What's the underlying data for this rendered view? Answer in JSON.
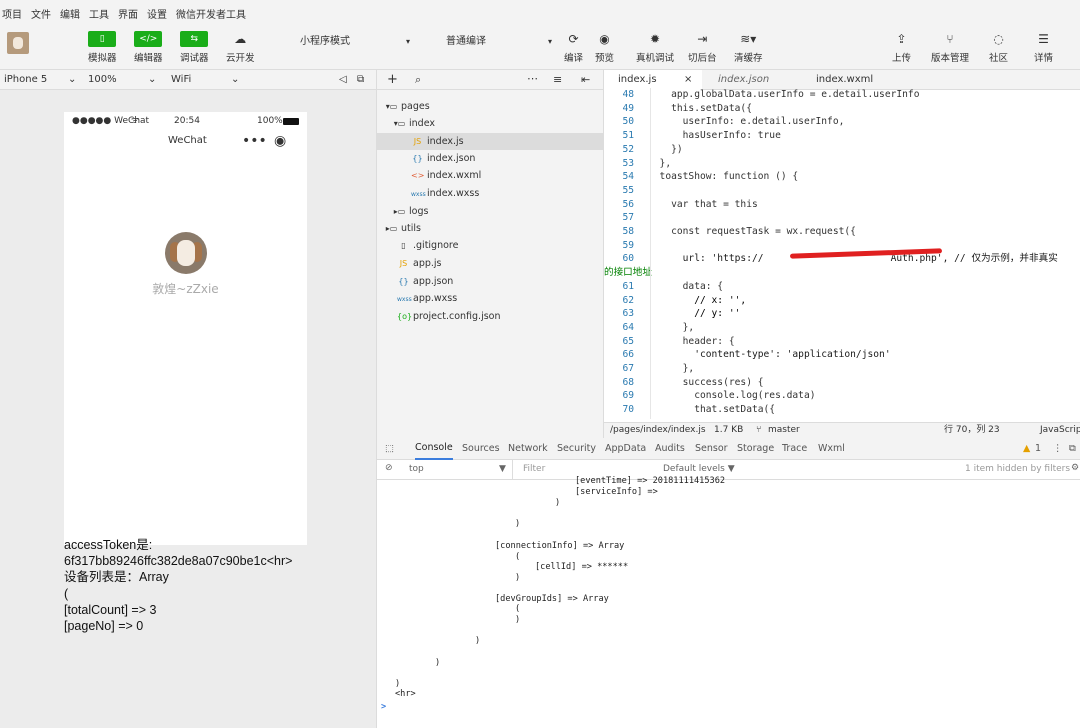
{
  "menu": [
    "项目",
    "文件",
    "编辑",
    "工具",
    "界面",
    "设置",
    "微信开发者工具"
  ],
  "toolbar": {
    "simulator": "模拟器",
    "editor": "编辑器",
    "debugger": "调试器",
    "cloud": "云开发",
    "mode": "小程序模式",
    "compile_mode": "普通编译",
    "compile": "编译",
    "preview": "预览",
    "remote_debug": "真机调试",
    "background": "切后台",
    "clear_cache": "清缓存",
    "upload": "上传",
    "version": "版本管理",
    "community": "社区",
    "details": "详情"
  },
  "device": {
    "model": "iPhone 5",
    "zoom": "100%",
    "network": "WiFi"
  },
  "phone": {
    "carrier": "●●●●● WeChat",
    "time": "20:54",
    "battery": "100%",
    "title": "WeChat",
    "nickname": "敦煌~zZxie"
  },
  "output": [
    "accessToken是:",
    "6f317bb89246ffc382de8a07c90be1c<hr>",
    "设备列表是：Array",
    "(",
    "[totalCount] => 3",
    "[pageNo] => 0"
  ],
  "files": {
    "pages": "pages",
    "index": "index",
    "index_js": "index.js",
    "index_json": "index.json",
    "index_wxml": "index.wxml",
    "index_wxss": "index.wxss",
    "logs": "logs",
    "utils": "utils",
    "gitignore": ".gitignore",
    "app_js": "app.js",
    "app_json": "app.json",
    "app_wxss": "app.wxss",
    "project_config": "project.config.json"
  },
  "editor_tabs": [
    "index.js",
    "index.json",
    "index.wxml"
  ],
  "code_lines": [
    {
      "n": "48",
      "t": "    app.globalData.userInfo = e.detail.userInfo"
    },
    {
      "n": "49",
      "t": "    this.setData({"
    },
    {
      "n": "50",
      "t": "      userInfo: e.detail.userInfo,"
    },
    {
      "n": "51",
      "t": "      hasUserInfo: true"
    },
    {
      "n": "52",
      "t": "    })"
    },
    {
      "n": "53",
      "t": "  },"
    },
    {
      "n": "54",
      "t": "  toastShow: function () {"
    },
    {
      "n": "55",
      "t": ""
    },
    {
      "n": "56",
      "t": "    var that = this"
    },
    {
      "n": "57",
      "t": ""
    },
    {
      "n": "58",
      "t": "    const requestTask = wx.request({"
    },
    {
      "n": "59",
      "t": ""
    },
    {
      "n": "60",
      "t": "      url: 'https://                      Auth.php', // 仅为示例，并非真实"
    },
    {
      "n": "",
      "t": "的接口地址"
    },
    {
      "n": "61",
      "t": "      data: {"
    },
    {
      "n": "62",
      "t": "        // x: '',"
    },
    {
      "n": "63",
      "t": "        // y: ''"
    },
    {
      "n": "64",
      "t": "      },"
    },
    {
      "n": "65",
      "t": "      header: {"
    },
    {
      "n": "66",
      "t": "        'content-type': 'application/json'"
    },
    {
      "n": "67",
      "t": "      },"
    },
    {
      "n": "68",
      "t": "      success(res) {"
    },
    {
      "n": "69",
      "t": "        console.log(res.data)"
    },
    {
      "n": "70",
      "t": "        that.setData({"
    }
  ],
  "editor_status": {
    "path": "/pages/index/index.js",
    "size": "1.7 KB",
    "branch": "master",
    "position": "行 70，列 23",
    "lang": "JavaScrip"
  },
  "devtools_tabs": [
    "Console",
    "Sources",
    "Network",
    "Security",
    "AppData",
    "Audits",
    "Sensor",
    "Storage",
    "Trace",
    "Wxml"
  ],
  "console": {
    "context": "top",
    "filter_placeholder": "Filter",
    "levels": "Default levels ▼",
    "hidden": "1 item hidden by filters",
    "warn_count": "1"
  },
  "log_lines": [
    "[eventTime] => 20181111415362",
    "[serviceInfo] =>",
    ")",
    ")",
    "[connectionInfo] => Array",
    "(",
    "[cellId] => ******",
    ")",
    "[devGroupIds] => Array",
    "(",
    ")",
    ")",
    ")",
    ")",
    "<hr>",
    ">"
  ]
}
